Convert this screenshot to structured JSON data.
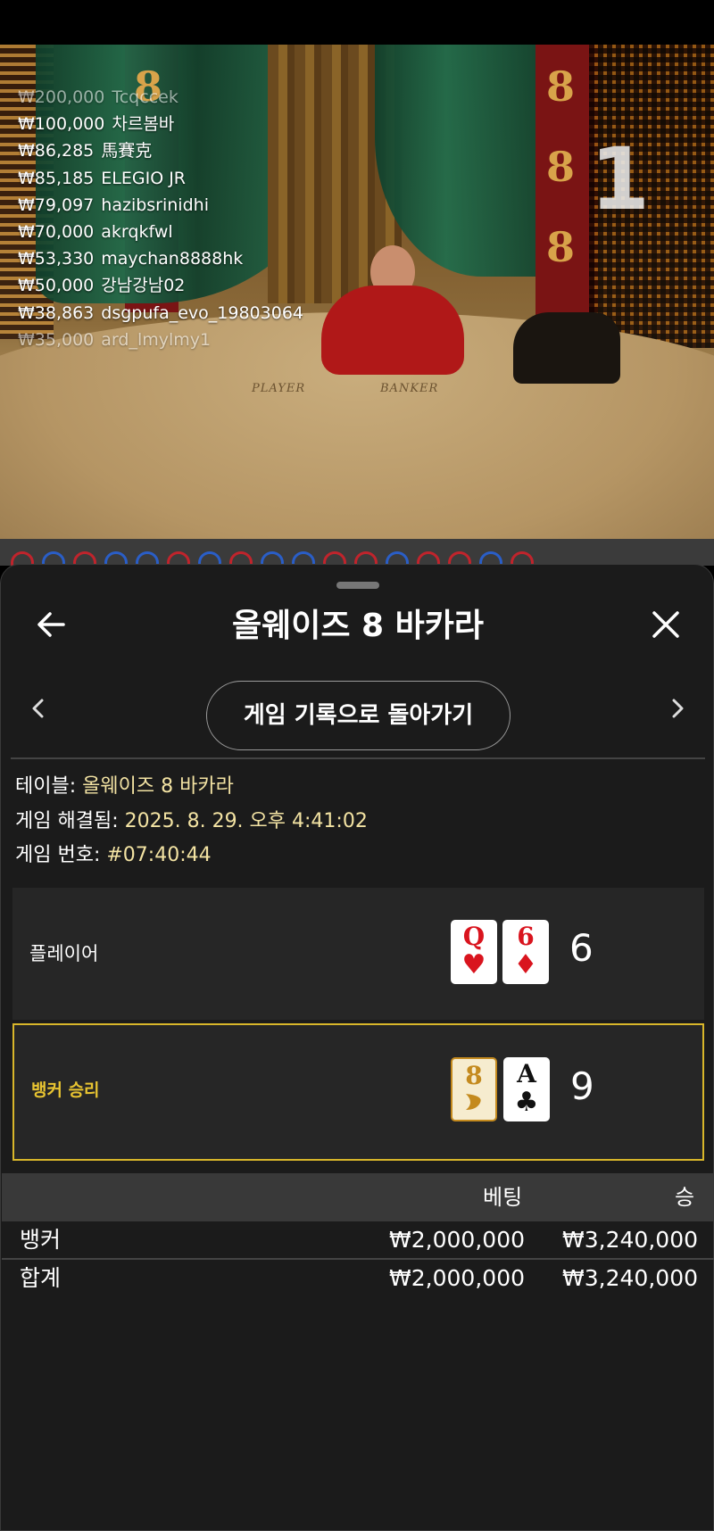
{
  "leaderboard": [
    {
      "amount": "₩200,000",
      "name": "Tcqccek"
    },
    {
      "amount": "₩100,000",
      "name": "차르봄바"
    },
    {
      "amount": "₩86,285",
      "name": "馬賽克"
    },
    {
      "amount": "₩85,185",
      "name": "ELEGIO JR"
    },
    {
      "amount": "₩79,097",
      "name": "hazibsrinidhi"
    },
    {
      "amount": "₩70,000",
      "name": "akrqkfwl"
    },
    {
      "amount": "₩53,330",
      "name": "maychan8888hk"
    },
    {
      "amount": "₩50,000",
      "name": "강남강남02"
    },
    {
      "amount": "₩38,863",
      "name": "dsgpufa_evo_19803064"
    },
    {
      "amount": "₩35,000",
      "name": "ard_lmylmy1"
    }
  ],
  "video": {
    "round_number": "1",
    "table_labels": {
      "player": "PLAYER",
      "banker": "BANKER"
    }
  },
  "header": {
    "title": "올웨이즈 8 바카라"
  },
  "history_button": "게임 기록으로 돌아가기",
  "info": {
    "table_label": "테이블: ",
    "table_value": "올웨이즈 8 바카라",
    "resolved_label": "게임 해결됨: ",
    "resolved_value": "2025. 8. 29. 오후 4:41:02",
    "game_no_label": "게임 번호: ",
    "game_no_value": "#07:40:44"
  },
  "player": {
    "label": "플레이어",
    "cards": [
      {
        "rank": "Q",
        "suit": "♥"
      },
      {
        "rank": "6",
        "suit": "♦"
      }
    ],
    "score": "6"
  },
  "banker": {
    "label": "뱅커 승리",
    "cards": [
      {
        "rank": "8",
        "suit": "gold-8"
      },
      {
        "rank": "A",
        "suit": "♣"
      }
    ],
    "score": "9"
  },
  "bets": {
    "headers": {
      "bet": "베팅",
      "win": "승"
    },
    "rows": [
      {
        "label": "뱅커",
        "bet": "₩2,000,000",
        "win": "₩3,240,000"
      },
      {
        "label": "합계",
        "bet": "₩2,000,000",
        "win": "₩3,240,000"
      }
    ]
  },
  "colors": {
    "accent_gold": "#d8b62a",
    "info_value": "#f3e3a3",
    "card_red": "#d9141e"
  }
}
